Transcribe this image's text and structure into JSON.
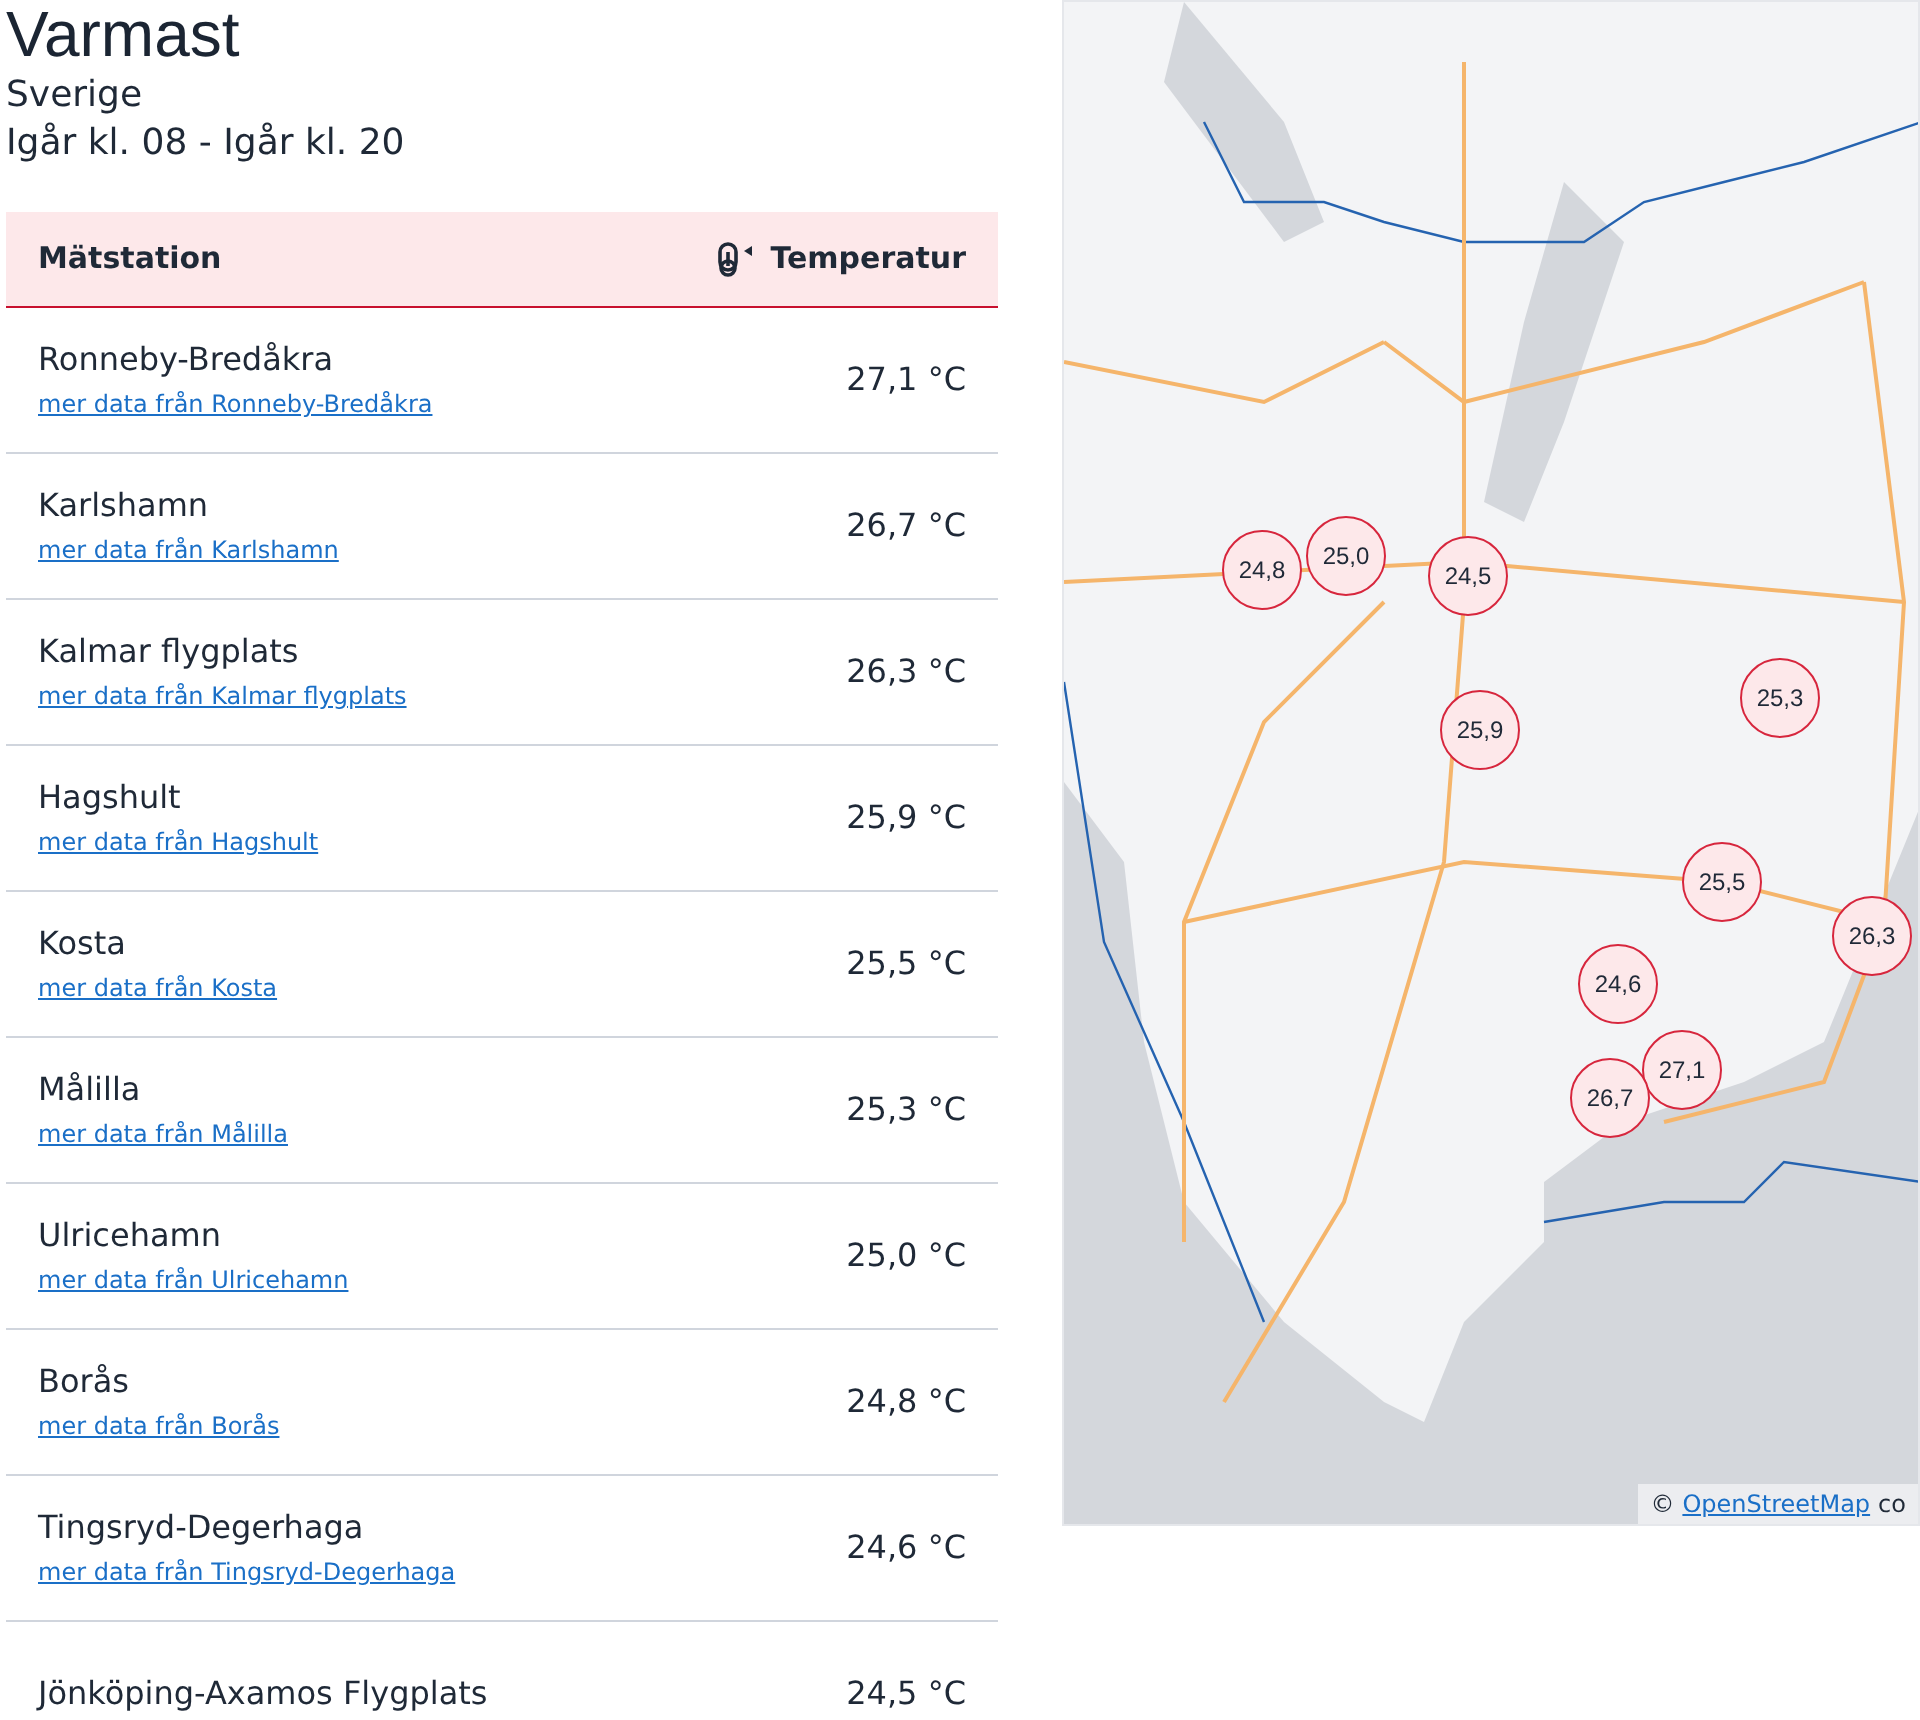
{
  "title": "Varmast",
  "region": "Sverige",
  "period": "Igår kl. 08 - Igår kl. 20",
  "table": {
    "columns": [
      "Mätstation",
      "Temperatur"
    ],
    "rows": [
      {
        "station": "Ronneby-Bredåkra",
        "link": "mer data från Ronneby-Bredåkra",
        "temperature": "27,1 °C"
      },
      {
        "station": "Karlshamn",
        "link": "mer data från Karlshamn",
        "temperature": "26,7 °C"
      },
      {
        "station": "Kalmar flygplats",
        "link": "mer data från Kalmar flygplats",
        "temperature": "26,3 °C"
      },
      {
        "station": "Hagshult",
        "link": "mer data från Hagshult",
        "temperature": "25,9 °C"
      },
      {
        "station": "Kosta",
        "link": "mer data från Kosta",
        "temperature": "25,5 °C"
      },
      {
        "station": "Målilla",
        "link": "mer data från Målilla",
        "temperature": "25,3 °C"
      },
      {
        "station": "Ulricehamn",
        "link": "mer data från Ulricehamn",
        "temperature": "25,0 °C"
      },
      {
        "station": "Borås",
        "link": "mer data från Borås",
        "temperature": "24,8 °C"
      },
      {
        "station": "Tingsryd-Degerhaga",
        "link": "mer data från Tingsryd-Degerhaga",
        "temperature": "24,6 °C"
      },
      {
        "station": "Jönköping-Axamos Flygplats",
        "temperature": "24,5 °C"
      }
    ]
  },
  "map": {
    "markers": [
      "27,1",
      "26,7",
      "26,3",
      "25,9",
      "25,5",
      "25,3",
      "25,0",
      "24,8",
      "24,6",
      "24,5"
    ],
    "attribution": {
      "symbol": "©",
      "link": "OpenStreetMap",
      "rest": "co"
    }
  }
}
